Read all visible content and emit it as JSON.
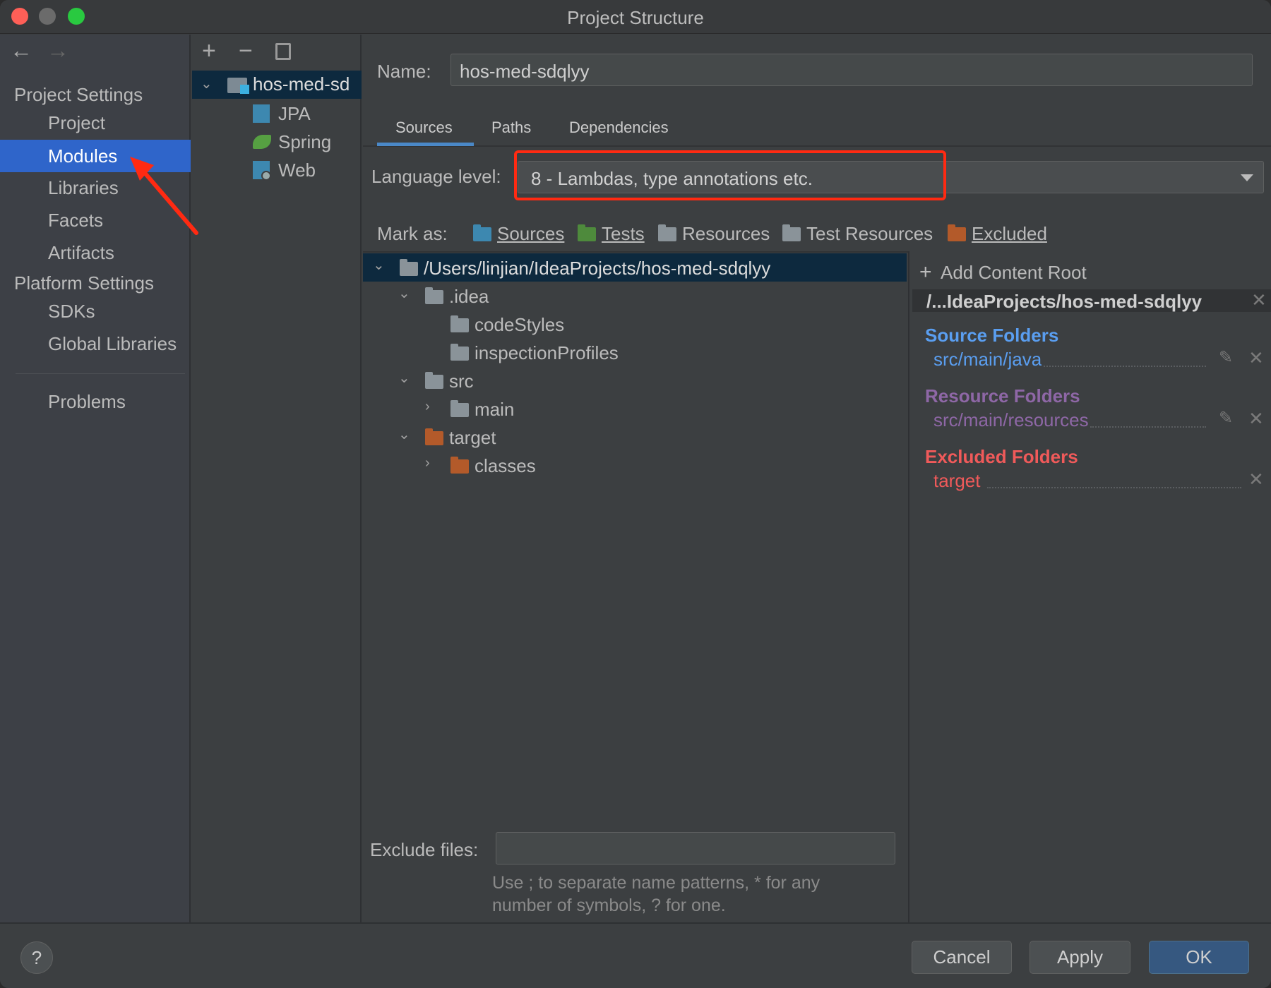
{
  "window": {
    "title": "Project Structure"
  },
  "sidebar": {
    "nav_back": "←",
    "nav_forward": "→",
    "project_settings_header": "Project Settings",
    "project_settings_items": [
      {
        "label": "Project"
      },
      {
        "label": "Modules",
        "selected": true
      },
      {
        "label": "Libraries"
      },
      {
        "label": "Facets"
      },
      {
        "label": "Artifacts"
      }
    ],
    "platform_settings_header": "Platform Settings",
    "platform_settings_items": [
      {
        "label": "SDKs"
      },
      {
        "label": "Global Libraries"
      }
    ],
    "problems": "Problems"
  },
  "module_panel": {
    "toolbar": {
      "add": "+",
      "remove": "−"
    },
    "root": "hos-med-sdqlyy",
    "root_visible": "hos-med-sd",
    "facets": [
      {
        "label": "JPA",
        "icon": "jpa-icon"
      },
      {
        "label": "Spring",
        "icon": "spring-leaf-icon"
      },
      {
        "label": "Web",
        "icon": "web-icon"
      }
    ]
  },
  "main": {
    "name_label": "Name:",
    "name_value": "hos-med-sdqlyy",
    "tabs": [
      {
        "label": "Sources",
        "active": true
      },
      {
        "label": "Paths"
      },
      {
        "label": "Dependencies"
      }
    ],
    "language_level_label": "Language level:",
    "language_level_value": "8 - Lambdas, type annotations etc.",
    "mark_as_label": "Mark as:",
    "mark_as": [
      {
        "label": "Sources",
        "color": "#3d88b0"
      },
      {
        "label": "Tests",
        "color": "#4e8a3c"
      },
      {
        "label": "Resources",
        "color": "#8a9399"
      },
      {
        "label": "Test Resources",
        "color": "#8a9399"
      },
      {
        "label": "Excluded",
        "color": "#b35a2a"
      }
    ],
    "tree": [
      {
        "label": "/Users/linjian/IdeaProjects/hos-med-sdqlyy",
        "expanded": true,
        "selected": true
      },
      {
        "label": ".idea",
        "expanded": true
      },
      {
        "label": "codeStyles"
      },
      {
        "label": "inspectionProfiles"
      },
      {
        "label": "src",
        "expanded": true
      },
      {
        "label": "main",
        "expanded": false
      },
      {
        "label": "target",
        "expanded": true,
        "excluded": true
      },
      {
        "label": "classes",
        "expanded": false,
        "excluded": true
      }
    ],
    "exclude_files_label": "Exclude files:",
    "exclude_files_value": "",
    "exclude_hint_1": "Use ; to separate name patterns, * for any",
    "exclude_hint_2": "number of symbols, ? for one."
  },
  "content_root": {
    "add_label": "Add Content Root",
    "root": "/...IdeaProjects/hos-med-sdqlyy",
    "source_header": "Source Folders",
    "source_path": "src/main/java",
    "source_color": "#5a9ef0",
    "resource_header": "Resource Folders",
    "resource_path": "src/main/resources",
    "resource_color": "#8e67a6",
    "excluded_header": "Excluded Folders",
    "excluded_path": "target",
    "excluded_color": "#f05a5a"
  },
  "footer": {
    "help": "?",
    "cancel": "Cancel",
    "apply": "Apply",
    "ok": "OK"
  },
  "annotations": {
    "highlight_color": "#ff2a12"
  }
}
